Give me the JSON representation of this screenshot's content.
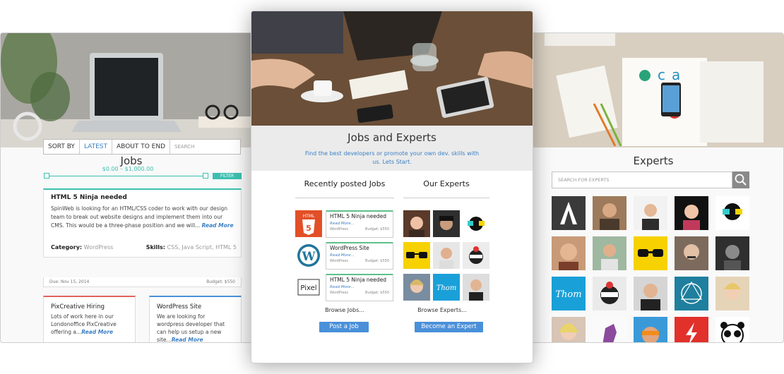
{
  "left_panel": {
    "title": "Jobs",
    "sort": {
      "label": "SORT BY",
      "options": [
        "LATEST",
        "ABOUT TO END"
      ],
      "search_placeholder": "SEARCH"
    },
    "range": {
      "text": "$0.00  –  $1,000.00",
      "filter_label": "FILTER"
    },
    "featured_job": {
      "title": "HTML 5 Ninja needed",
      "description": "SpinWeb is looking for an HTML/CSS coder to work with our design team to break out website designs and implement them into our CMS. This would be a three-phase position and we will...",
      "read_more": "Read More",
      "category_label": "Category:",
      "category_value": "WordPress",
      "skills_label": "Skills:",
      "skills_value": "CSS, Java Script, HTML 5",
      "due": "Due: Nov 15, 2014",
      "budget": "Budget: $550"
    },
    "cards": [
      {
        "title": "PixCreative Hiring",
        "description": "Lots of work here in our Londonoffice PixCreative offering a...",
        "read_more": "Read More"
      },
      {
        "title": "WordPress Site",
        "description": "We are looking for wordpress developer that can help us setup a new site...",
        "read_more": "Read More"
      }
    ]
  },
  "center_panel": {
    "title": "Jobs and Experts",
    "subtitle": "Find the best developers or promote your own dev. skills with us. Lets Start.",
    "jobs_heading": "Recently posted Jobs",
    "experts_heading": "Our Experts",
    "jobs": [
      {
        "title": "HTML 5 Ninja needed",
        "read_more": "Read More...",
        "category": "WordPress",
        "budget": "Budget: $550",
        "logo": "html5-logo"
      },
      {
        "title": "WordPress Site",
        "read_more": "Read More...",
        "category": "WordPress",
        "budget": "Budget: $550",
        "logo": "wordpress-logo"
      },
      {
        "title": "HTML 5 Ninja needed",
        "read_more": "Read More...",
        "category": "WordPress",
        "budget": "Budget: $550",
        "logo": "pixel-logo"
      }
    ],
    "pixel_logo_text": "Pixel",
    "browse_jobs": "Browse Jobs...",
    "browse_experts": "Browse Experts...",
    "post_job": "Post a Job",
    "become_expert": "Become an Expert"
  },
  "right_panel": {
    "title": "Experts",
    "search_placeholder": "SEARCH FOR EXPERTS"
  },
  "colors": {
    "accent_teal": "#3cbfb0",
    "accent_blue": "#4a90d9",
    "link_blue": "#3b7fc4"
  }
}
